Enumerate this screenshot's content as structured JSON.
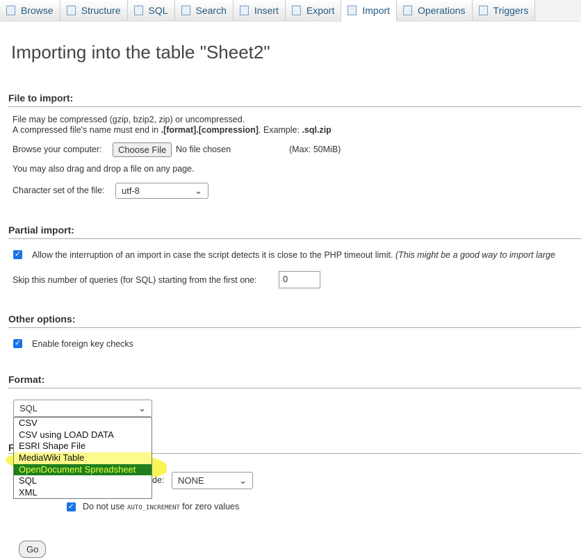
{
  "tabs": [
    {
      "label": "Browse",
      "icon": "browse-icon"
    },
    {
      "label": "Structure",
      "icon": "structure-icon"
    },
    {
      "label": "SQL",
      "icon": "sql-icon"
    },
    {
      "label": "Search",
      "icon": "search-icon"
    },
    {
      "label": "Insert",
      "icon": "insert-icon"
    },
    {
      "label": "Export",
      "icon": "export-icon"
    },
    {
      "label": "Import",
      "icon": "import-icon",
      "active": true
    },
    {
      "label": "Operations",
      "icon": "wrench-icon"
    },
    {
      "label": "Triggers",
      "icon": "triggers-icon"
    }
  ],
  "title": "Importing into the table \"Sheet2\"",
  "file": {
    "heading": "File to import:",
    "line1": "File may be compressed (gzip, bzip2, zip) or uncompressed.",
    "line2a": "A compressed file's name must end in ",
    "line2b": ".[format].[compression]",
    "line2c": ". Example: ",
    "line2d": ".sql.zip",
    "browse_label": "Browse your computer:",
    "choose_button": "Choose File",
    "no_file": "No file chosen",
    "max": "(Max: 50MiB)",
    "drag": "You may also drag and drop a file on any page.",
    "charset_label": "Character set of the file:",
    "charset_value": "utf-8"
  },
  "partial": {
    "heading": "Partial import:",
    "allow_label": "Allow the interruption of an import in case the script detects it is close to the PHP timeout limit.",
    "allow_note": "(This might be a good way to import large",
    "skip_label": "Skip this number of queries (for SQL) starting from the first one:",
    "skip_value": "0"
  },
  "other": {
    "heading": "Other options:",
    "fk_label": "Enable foreign key checks"
  },
  "format": {
    "heading": "Format:",
    "selected": "SQL",
    "options": [
      "CSV",
      "CSV using LOAD DATA",
      "ESRI Shape File",
      "MediaWiki Table",
      "OpenDocument Spreadsheet",
      "SQL",
      "XML"
    ],
    "highlighted": "OpenDocument Spreadsheet"
  },
  "format_specific": {
    "heading_partial": "F",
    "mode_label_partial": "de:",
    "mode_value": "NONE",
    "auto_inc_a": "Do not use ",
    "auto_inc_code": "AUTO_INCREMENT",
    "auto_inc_b": " for zero values"
  },
  "go_button": "Go",
  "colors": {
    "highlight": "#f7f53a",
    "selected_option": "#1e7f1e",
    "link": "#235a81"
  }
}
